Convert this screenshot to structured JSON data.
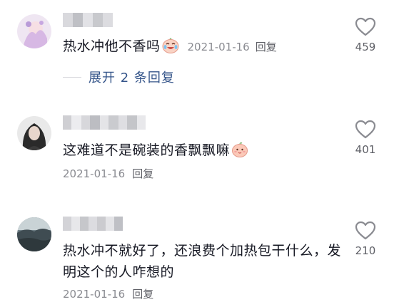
{
  "comments": [
    {
      "text": "热水冲他不香吗",
      "date": "2021-01-16",
      "reply_label": "回复",
      "likes": "459",
      "expand_label": "展开 2 条回复",
      "emoji_icon": "crying-laughing-face-icon"
    },
    {
      "text": "这难道不是碗装的香飘飘嘛",
      "date": "2021-01-16",
      "reply_label": "回复",
      "likes": "401",
      "emoji_icon": "peach-face-icon"
    },
    {
      "text": "热水冲不就好了，还浪费个加热包干什么，发明这个的人咋想的",
      "date": "2021-01-16",
      "reply_label": "回复",
      "likes": "210"
    }
  ],
  "colors": {
    "text": "#161823",
    "meta": "#8a8b91",
    "link": "#35558a",
    "heart_stroke": "#8a8b91"
  }
}
